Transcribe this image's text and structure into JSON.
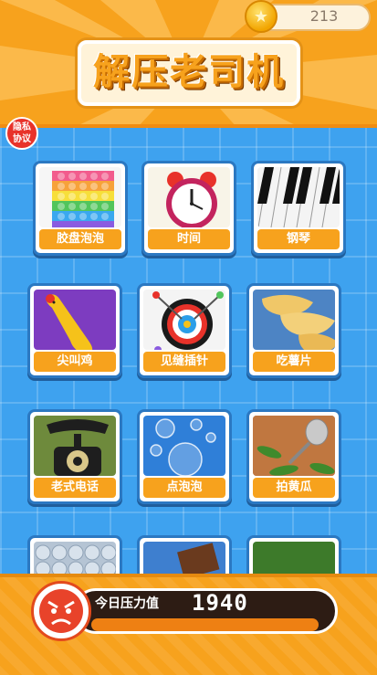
{
  "header": {
    "title": "解压老司机",
    "coins": "213",
    "privacy_label": "隐私\n协议"
  },
  "games": [
    {
      "label": "胶盘泡泡",
      "icon": "pop-it-icon"
    },
    {
      "label": "时间",
      "icon": "alarm-clock-icon"
    },
    {
      "label": "钢琴",
      "icon": "piano-icon"
    },
    {
      "label": "尖叫鸡",
      "icon": "rubber-chicken-icon"
    },
    {
      "label": "见缝插针",
      "icon": "target-pins-icon"
    },
    {
      "label": "吃薯片",
      "icon": "potato-chips-icon"
    },
    {
      "label": "老式电话",
      "icon": "old-telephone-icon"
    },
    {
      "label": "点泡泡",
      "icon": "bubbles-icon"
    },
    {
      "label": "拍黄瓜",
      "icon": "cucumber-icon"
    }
  ],
  "pressure": {
    "label": "今日压力值",
    "value": "1940",
    "level_fraction": 0.95
  },
  "colors": {
    "accent": "#f7a21d",
    "background": "#3ea2ef",
    "card_border": "#2b78c2"
  }
}
